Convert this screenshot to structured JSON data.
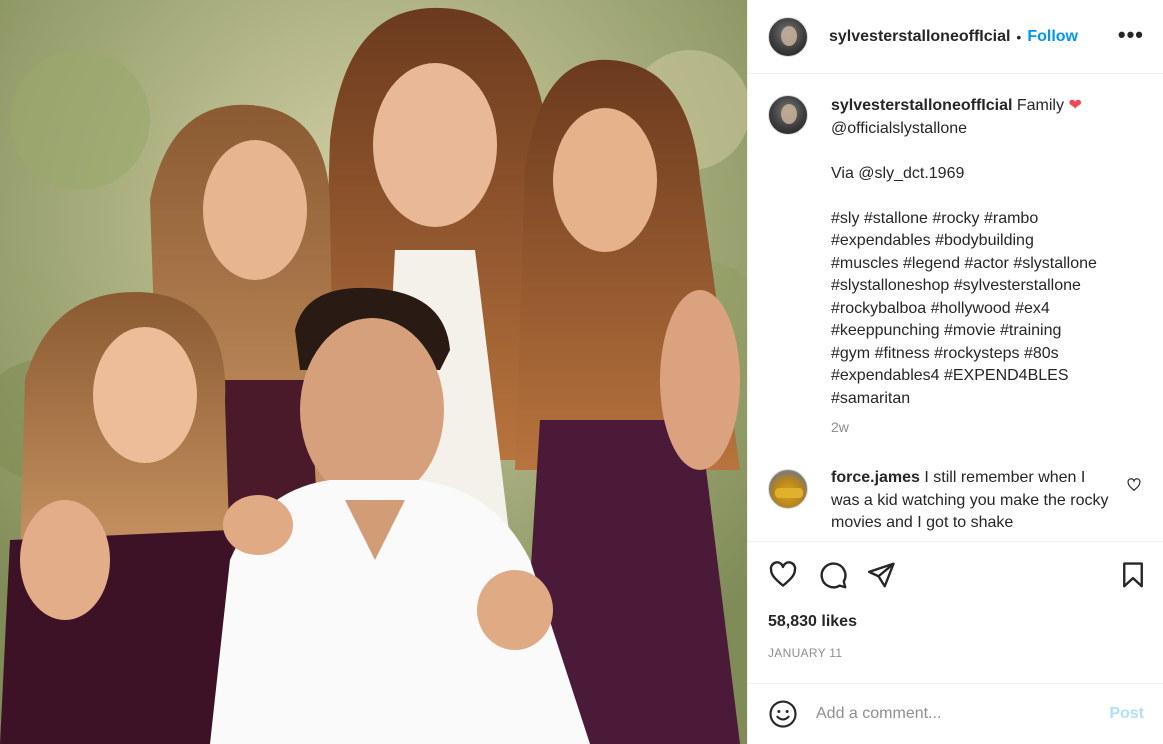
{
  "post": {
    "image_alt": "family-photo",
    "header": {
      "username": "sylvesterstalloneoffIcial",
      "separator": "•",
      "follow_label": "Follow",
      "more_icon": "•••"
    },
    "caption": {
      "username": "sylvesterstalloneoffIcial",
      "text_intro": "Family",
      "heart": "❤",
      "mention": "@officialslystallone",
      "via": "Via @sly_dct.1969",
      "hashtag_lines": [
        "#sly #stallone #rocky #rambo",
        "#expendables #bodybuilding",
        "#muscles #legend #actor #slystallone",
        "#slystalloneshop #sylvesterstallone",
        "#rockybalboa #hollywood #ex4",
        "#keeppunching #movie #training",
        "#gym #fitness #rockysteps #80s",
        "#expendables4 #EXPEND4BLES",
        "#samaritan"
      ],
      "time": "2w"
    },
    "comment": {
      "username": "force.james",
      "text": "I still remember when I was a kid watching you make the rocky movies and I got to shake"
    },
    "likes": "58,830 likes",
    "date": "JANUARY 11",
    "add_comment": {
      "placeholder": "Add a comment...",
      "post_label": "Post"
    }
  },
  "colors": {
    "accent": "#0095f6",
    "post_disabled": "#b2dffc",
    "muted": "#8e8e8e",
    "heart": "#ed4956"
  },
  "icons": [
    "heart-icon",
    "comment-icon",
    "share-icon",
    "bookmark-icon",
    "emoji-icon",
    "more-icon"
  ]
}
